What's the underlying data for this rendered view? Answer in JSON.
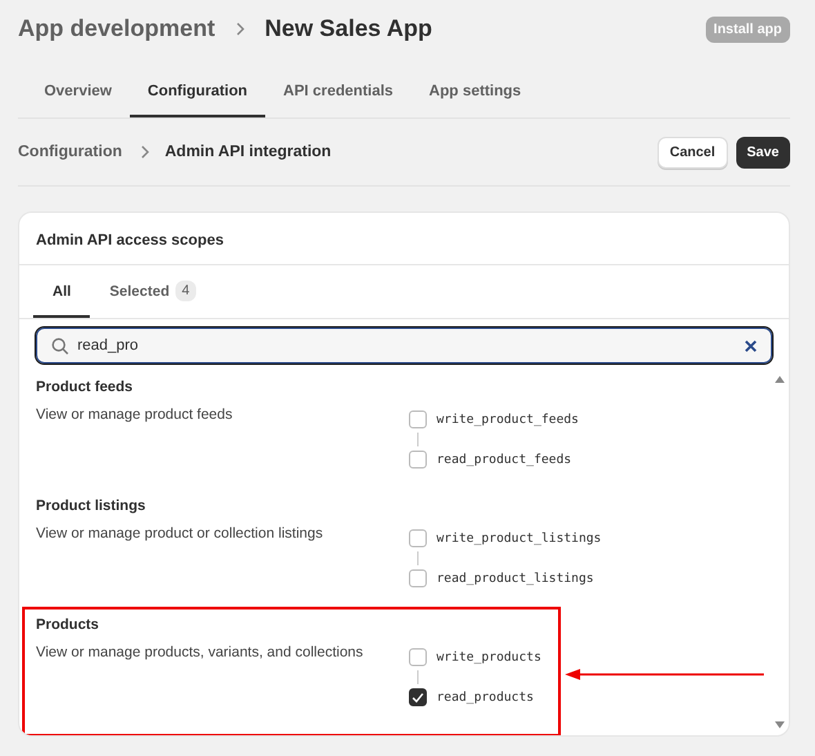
{
  "header": {
    "breadcrumb_parent": "App development",
    "title": "New Sales App",
    "install_button": {
      "label": "Install app",
      "disabled": true
    }
  },
  "tabs": [
    {
      "label": "Overview",
      "selected": false
    },
    {
      "label": "Configuration",
      "selected": true
    },
    {
      "label": "API credentials",
      "selected": false
    },
    {
      "label": "App settings",
      "selected": false
    }
  ],
  "subheader": {
    "breadcrumb_parent": "Configuration",
    "title": "Admin API integration",
    "buttons": {
      "cancel": "Cancel",
      "save": "Save"
    }
  },
  "card": {
    "title": "Admin API access scopes",
    "tabs": [
      {
        "label": "All",
        "selected": true
      },
      {
        "label": "Selected",
        "count": "4",
        "selected": false
      }
    ],
    "search": {
      "value": "read_pro"
    },
    "sections": [
      {
        "name": "Product feeds",
        "description": "View or manage product feeds",
        "highlighted": false,
        "scopes": [
          {
            "label": "write_product_feeds",
            "checked": false
          },
          {
            "label": "read_product_feeds",
            "checked": false
          }
        ]
      },
      {
        "name": "Product listings",
        "description": "View or manage product or collection listings",
        "highlighted": false,
        "scopes": [
          {
            "label": "write_product_listings",
            "checked": false
          },
          {
            "label": "read_product_listings",
            "checked": false
          }
        ]
      },
      {
        "name": "Products",
        "description": "View or manage products, variants, and collections",
        "highlighted": true,
        "scopes": [
          {
            "label": "write_products",
            "checked": false
          },
          {
            "label": "read_products",
            "checked": true
          }
        ]
      }
    ]
  }
}
